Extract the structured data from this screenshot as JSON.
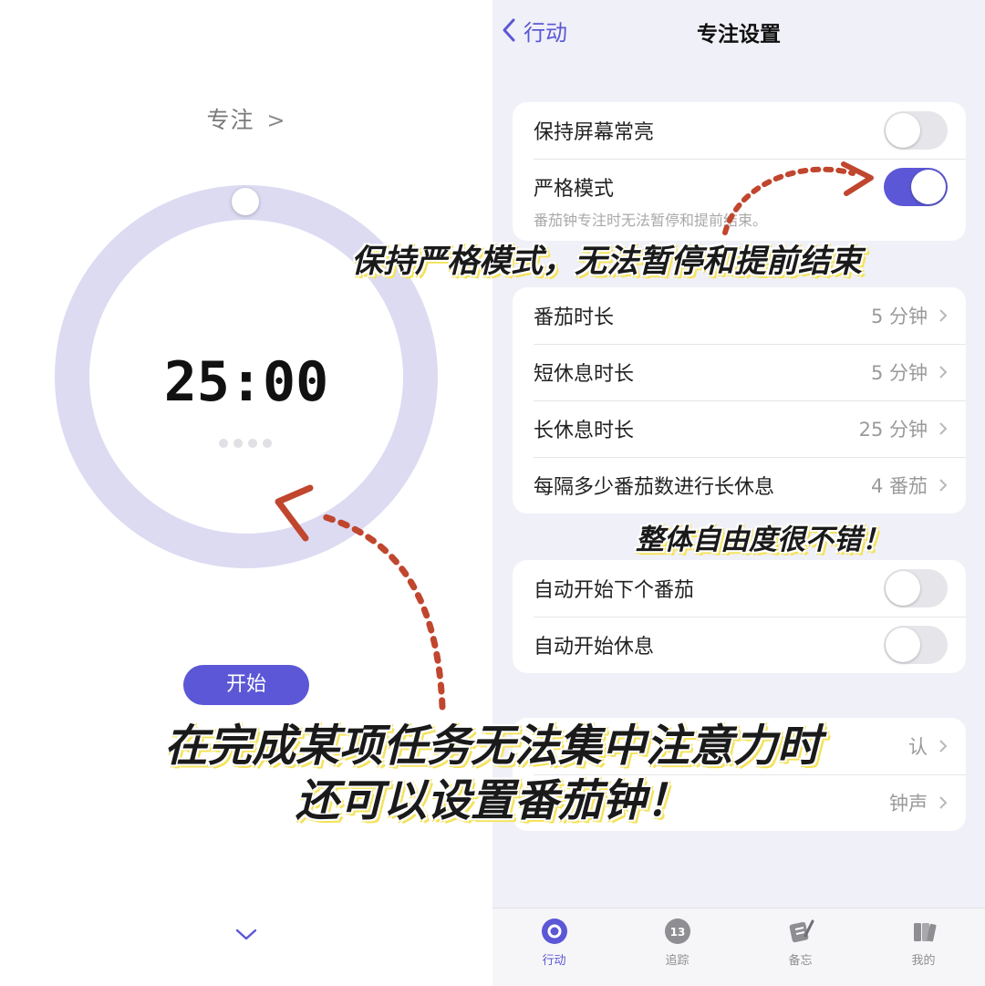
{
  "left": {
    "focus_title": "专注",
    "timer": "25:00",
    "start_label": "开始"
  },
  "nav": {
    "back_label": "行动",
    "title": "专注设置"
  },
  "settings": {
    "group1": {
      "keep_screen_on": {
        "label": "保持屏幕常亮",
        "toggle": false
      },
      "strict_mode": {
        "label": "严格模式",
        "toggle": true
      },
      "note": "番茄钟专注时无法暂停和提前结束。"
    },
    "group2": [
      {
        "label": "番茄时长",
        "value": "5 分钟"
      },
      {
        "label": "短休息时长",
        "value": "5 分钟"
      },
      {
        "label": "长休息时长",
        "value": "25 分钟"
      },
      {
        "label": "每隔多少番茄数进行长休息",
        "value": "4 番茄"
      }
    ],
    "group3": {
      "auto_next": {
        "label": "自动开始下个番茄",
        "toggle": false
      },
      "auto_break": {
        "label": "自动开始休息",
        "toggle": false
      }
    },
    "group4": [
      {
        "label": "",
        "value": "认"
      },
      {
        "label": "",
        "value": "钟声"
      }
    ]
  },
  "tabbar": {
    "tabs": [
      {
        "label": "行动",
        "icon": "target-icon",
        "active": true
      },
      {
        "label": "追踪",
        "icon": "badge-13-icon",
        "badge": "13",
        "active": false
      },
      {
        "label": "备忘",
        "icon": "memo-pen-icon",
        "active": false
      },
      {
        "label": "我的",
        "icon": "books-icon",
        "active": false
      }
    ]
  },
  "captions": {
    "strict": "保持严格模式，无法暂停和提前结束",
    "freedom": "整体自由度很不错！",
    "main_line1": "在完成某项任务无法集中注意力时",
    "main_line2": "还可以设置番茄钟！"
  },
  "colors": {
    "accent": "#5b57d6",
    "ring": "#dcdbf2",
    "panel_bg": "#f0f0f8",
    "arrow": "#c0462e",
    "caption_highlight": "#f4e25a"
  }
}
